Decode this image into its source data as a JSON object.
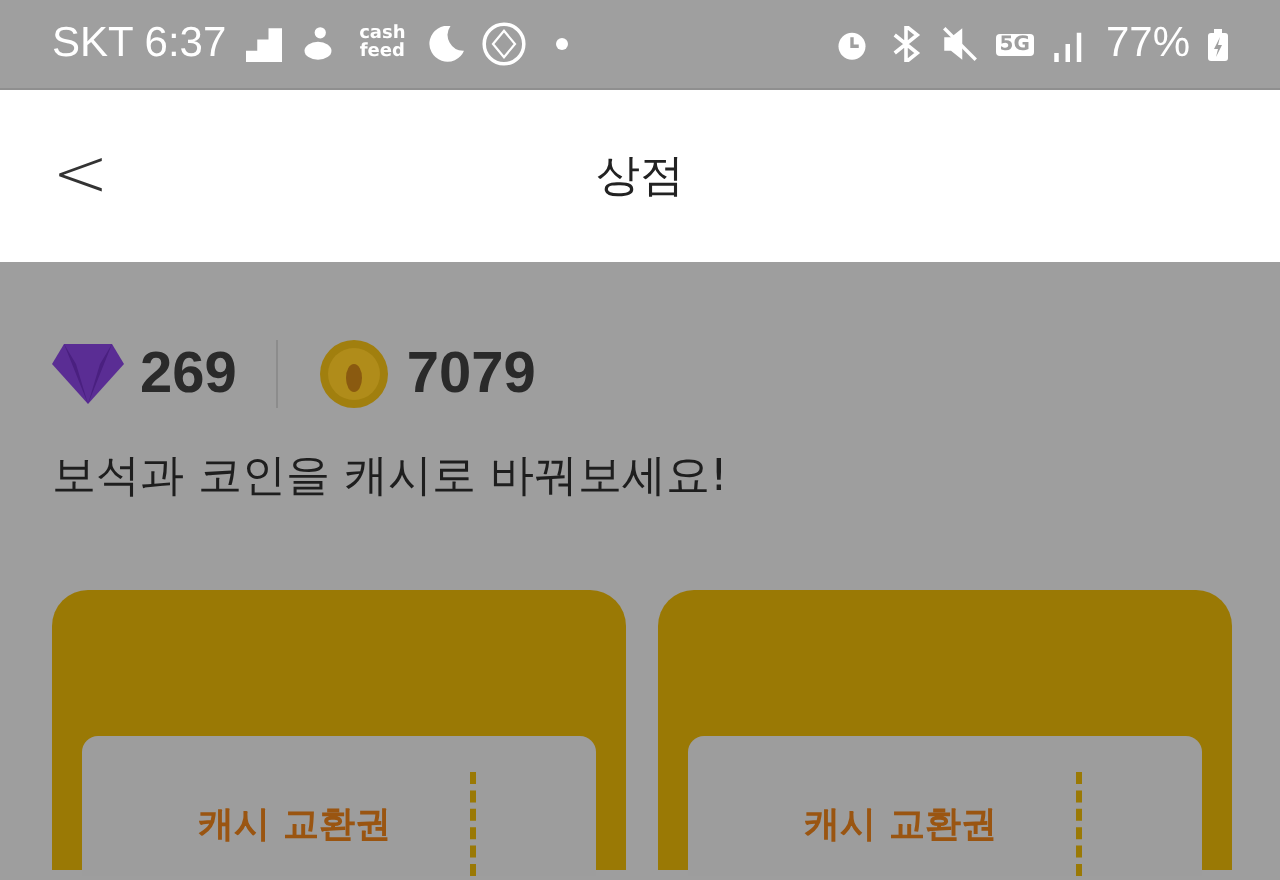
{
  "status_bar": {
    "carrier": "SKT",
    "time": "6:37",
    "app_badge": "cash feed",
    "network": "5G",
    "battery": "77%"
  },
  "header": {
    "back": "<",
    "title": "상점"
  },
  "balance": {
    "gems": "269",
    "coins": "7079"
  },
  "message": "보석과 코인을 캐시로 바꿔보세요!",
  "vouchers": [
    {
      "title": "캐시 교환권"
    },
    {
      "title": "캐시 교환권"
    }
  ]
}
